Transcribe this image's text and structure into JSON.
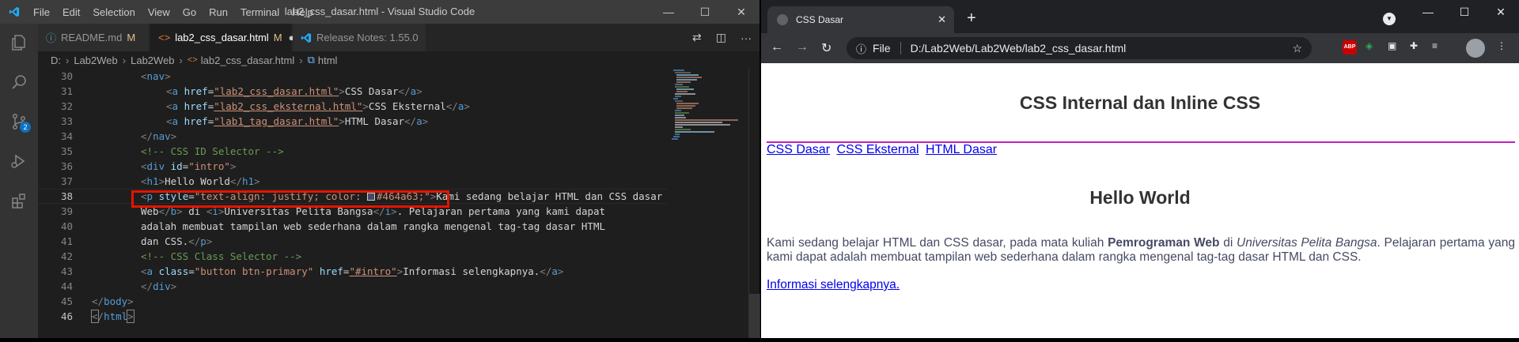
{
  "vscode": {
    "menu": [
      "File",
      "Edit",
      "Selection",
      "View",
      "Go",
      "Run",
      "Terminal",
      "Help"
    ],
    "window_title": "lab2_css_dasar.html - Visual Studio Code",
    "tabs": [
      {
        "label": "README.md",
        "modified": "M"
      },
      {
        "label": "lab2_css_dasar.html",
        "modified": "M"
      },
      {
        "label": "Release Notes: 1.55.0",
        "modified": ""
      }
    ],
    "breadcrumb": [
      "D:",
      "Lab2Web",
      "Lab2Web",
      "lab2_css_dasar.html",
      "html"
    ],
    "scm_badge": "2",
    "line_numbers": [
      "30",
      "31",
      "32",
      "33",
      "34",
      "35",
      "36",
      "37",
      "38",
      "39",
      "40",
      "41",
      "42",
      "43",
      "44",
      "45",
      "46"
    ],
    "code": {
      "l30_tag": "nav",
      "l31_href": "\"lab2_css_dasar.html\"",
      "l31_text": "CSS Dasar",
      "l32_href": "\"lab2_css_eksternal.html\"",
      "l32_text": "CSS Eksternal",
      "l33_href": "\"lab1_tag_dasar.html\"",
      "l33_text": "HTML Dasar",
      "l34_tag": "nav",
      "l35_comment": "<!-- CSS ID Selector -->",
      "l36_id": "\"intro\"",
      "l37_text": "Hello World",
      "l38_style_a": "\"text-align: justify; color: ",
      "l38_style_b": "#464a63;\"",
      "l38_text": "Kami sedang belajar HTML dan CSS dasar",
      "l39_a": "Web",
      "l39_b": " di ",
      "l39_c": "Universitas Pelita Bangsa",
      "l39_d": ". Pelajaran pertama yang kami dapat",
      "l40_text": "adalah membuat tampilan web sederhana dalam rangka mengenal tag-tag dasar HTML",
      "l41_text": "dan CSS.",
      "l42_comment": "<!-- CSS Class Selector -->",
      "l43_class": "\"button btn-primary\"",
      "l43_href": "\"#intro\"",
      "l43_text": "Informasi selengkapnya.",
      "l44_tag": "div",
      "l45_tag": "body",
      "l46_tag": "html"
    }
  },
  "browser": {
    "tab_title": "CSS Dasar",
    "omnibox_scheme": "File",
    "url": "D:/Lab2Web/Lab2Web/lab2_css_dasar.html",
    "abp_label": "ABP",
    "page": {
      "heading": "CSS Internal dan Inline CSS",
      "nav_links": [
        "CSS Dasar",
        "CSS Eksternal",
        "HTML Dasar"
      ],
      "intro_heading": "Hello World",
      "para_a": "Kami sedang belajar HTML dan CSS dasar, pada mata kuliah ",
      "para_b": "Pemrograman Web",
      "para_c": " di ",
      "para_d": "Universitas Pelita Bangsa",
      "para_e": ". Pelajaran pertama yang kami dapat adalah membuat tampilan web sederhana dalam rangka mengenal tag-tag dasar HTML dan CSS.",
      "more_link": "Informasi selengkapnya."
    }
  },
  "colors": {
    "highlight_box": "#e51400",
    "para_text": "#464a63",
    "nav_border": "#c020c0"
  }
}
